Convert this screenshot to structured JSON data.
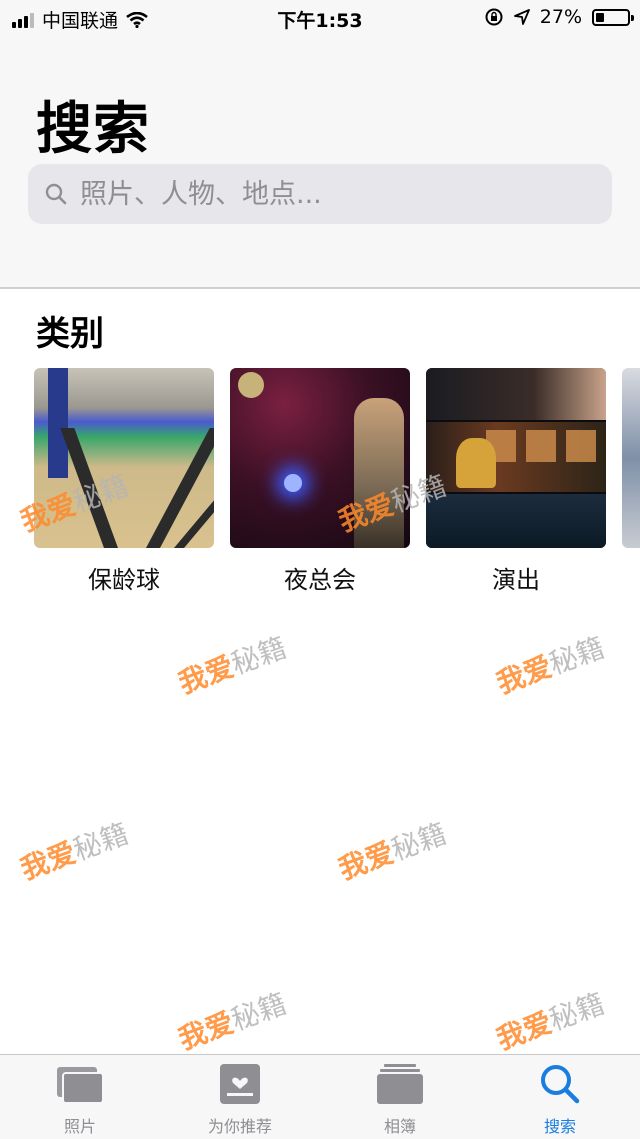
{
  "status_bar": {
    "carrier": "中国联通",
    "time": "下午1:53",
    "battery_percent": "27%",
    "battery_level": 0.27
  },
  "header": {
    "title": "搜索",
    "search_placeholder": "照片、人物、地点..."
  },
  "categories_section": {
    "title": "类别",
    "items": [
      {
        "label": "保龄球"
      },
      {
        "label": "夜总会"
      },
      {
        "label": "演出"
      }
    ]
  },
  "watermark": {
    "part1": "我爱",
    "part2": "秘籍"
  },
  "tabbar": {
    "tabs": [
      {
        "label": "照片",
        "icon": "photos-icon",
        "active": false
      },
      {
        "label": "为你推荐",
        "icon": "for-you-icon",
        "active": false
      },
      {
        "label": "相簿",
        "icon": "albums-icon",
        "active": false
      },
      {
        "label": "搜索",
        "icon": "search-icon",
        "active": true
      }
    ]
  },
  "colors": {
    "accent": "#1a7de0",
    "inactive": "#8e8e93",
    "watermark_orange": "#ff8a2b"
  }
}
